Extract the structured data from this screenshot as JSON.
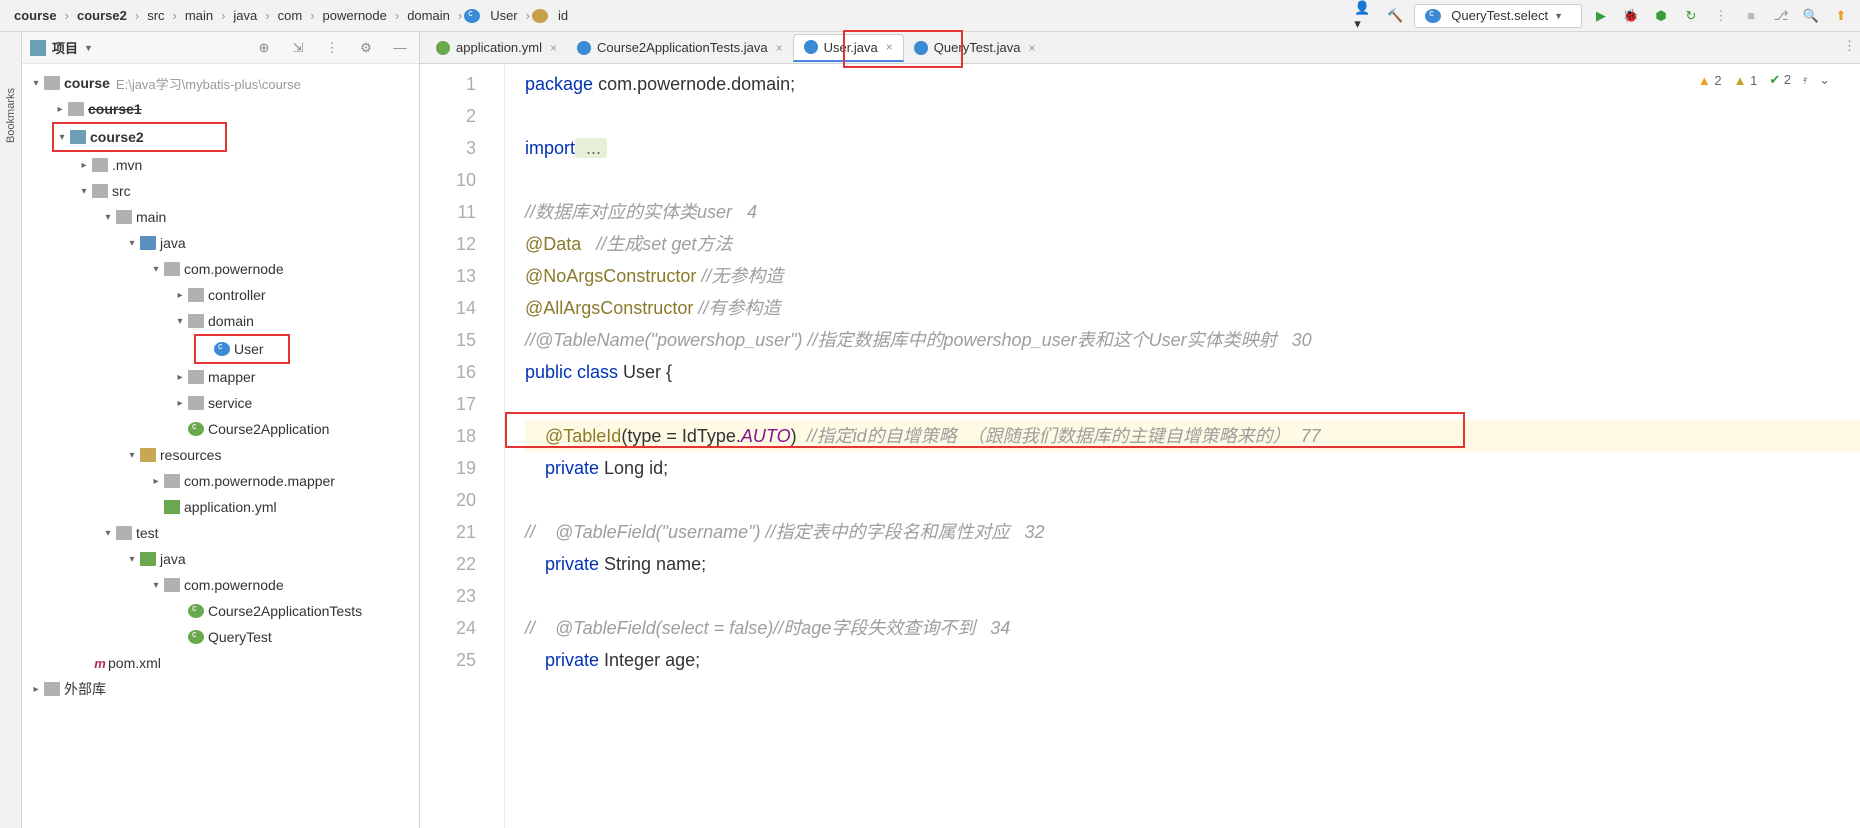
{
  "breadcrumb": [
    "course",
    "course2",
    "src",
    "main",
    "java",
    "com",
    "powernode",
    "domain",
    "User",
    "id"
  ],
  "breadcrumb_icons": [
    "",
    "",
    "",
    "",
    "",
    "",
    "",
    "",
    "class",
    "field"
  ],
  "run_config": "QueryTest.select",
  "project_panel": {
    "title": "项目"
  },
  "vertical_tab": "Bookmarks",
  "bottom_label": "外部库",
  "tree": {
    "root": {
      "name": "course",
      "path": "E:\\java学习\\mybatis-plus\\course"
    },
    "course1": "course1",
    "course2": "course2",
    "mvn": ".mvn",
    "src": "src",
    "main": "main",
    "java": "java",
    "pkg": "com.powernode",
    "controller": "controller",
    "domain": "domain",
    "user": "User",
    "mapper": "mapper",
    "service": "service",
    "app": "Course2Application",
    "resources": "resources",
    "respkg": "com.powernode.mapper",
    "appyml": "application.yml",
    "test": "test",
    "tjava": "java",
    "tpkg": "com.powernode",
    "tests": "Course2ApplicationTests",
    "qt": "QueryTest",
    "pom": "pom.xml"
  },
  "tabs": [
    {
      "label": "application.yml",
      "icon": "yml"
    },
    {
      "label": "Course2ApplicationTests.java",
      "icon": "java"
    },
    {
      "label": "User.java",
      "icon": "java",
      "active": true
    },
    {
      "label": "QueryTest.java",
      "icon": "java"
    }
  ],
  "inspections": {
    "warn1": "2",
    "warn2": "1",
    "ok": "2"
  },
  "code": {
    "lines": [
      "1",
      "2",
      "3",
      "10",
      "11",
      "12",
      "13",
      "14",
      "15",
      "16",
      "17",
      "18",
      "19",
      "20",
      "21",
      "22",
      "23",
      "24",
      "25"
    ],
    "l1_a": "package",
    "l1_b": " com.powernode.domain;",
    "l3_a": "import",
    "l3_b": " ...",
    "l11": "//数据库对应的实体类user   4",
    "l12_a": "@Data",
    "l12_b": "   //生成set get方法",
    "l13_a": "@NoArgsConstructor",
    "l13_b": " //无参构造",
    "l14_a": "@AllArgsConstructor",
    "l14_b": " //有参构造",
    "l15": "//@TableName(\"powershop_user\") //指定数据库中的powershop_user表和这个User实体类映射   30",
    "l16_a": "public class",
    "l16_b": " User {",
    "l18_a": "    @TableId",
    "l18_b": "(type = IdType.",
    "l18_c": "AUTO",
    "l18_d": ")  ",
    "l18_e": "//指定id的自增策略  （跟随我们数据库的主键自增策略来的）  77",
    "l19_a": "    private",
    "l19_b": " Long id;",
    "l21": "//    @TableField(\"username\") //指定表中的字段名和属性对应   32",
    "l22_a": "    private",
    "l22_b": " String name;",
    "l24": "//    @TableField(select = false)//时age字段失效查询不到   34",
    "l25_a": "    private",
    "l25_b": " Integer age;"
  }
}
